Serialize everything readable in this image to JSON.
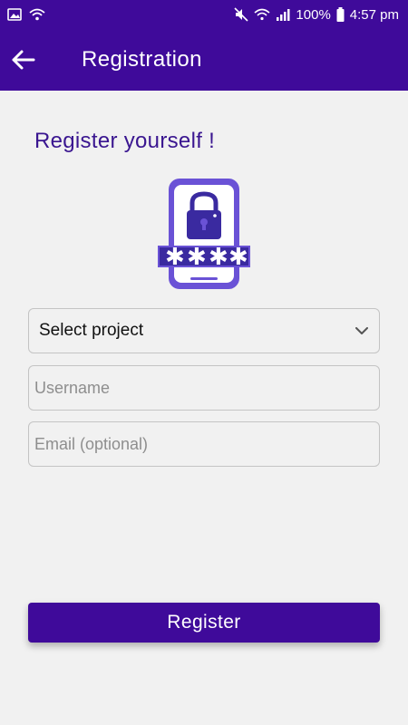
{
  "status_bar": {
    "battery": "100%",
    "time": "4:57 pm",
    "icons": [
      "image-icon",
      "wifi-icon",
      "mute-icon",
      "wifi-signal-icon",
      "cell-signal-icon",
      "battery-icon"
    ]
  },
  "app_bar": {
    "title": "Registration",
    "back_icon": "arrow-left-icon"
  },
  "main": {
    "heading": "Register yourself !",
    "illustration_icon": "phone-lock-password-icon",
    "project_select": {
      "value": "Select project"
    },
    "username": {
      "placeholder": "Username",
      "value": ""
    },
    "email": {
      "placeholder": "Email (optional)",
      "value": ""
    },
    "register_label": "Register"
  },
  "colors": {
    "primary": "#3f0a9a",
    "heading": "#3a1690",
    "illustration": "#6a52d6",
    "background": "#f1f1f1"
  }
}
